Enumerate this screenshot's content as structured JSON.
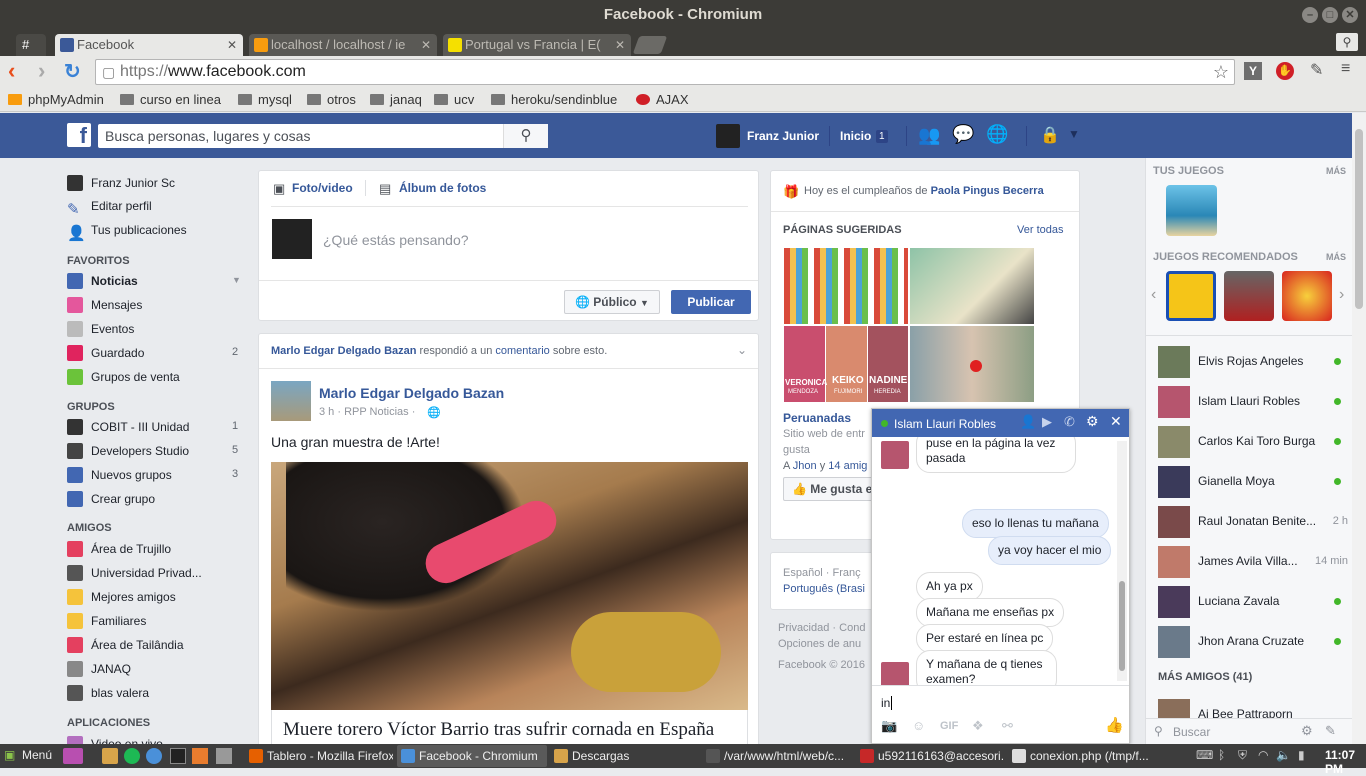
{
  "window": {
    "title": "Facebook - Chromium"
  },
  "tabs": [
    {
      "label": "#",
      "active": false
    },
    {
      "label": "Facebook",
      "active": true
    },
    {
      "label": "localhost / localhost / ie",
      "active": false
    },
    {
      "label": "Portugal vs Francia | E(",
      "active": false
    }
  ],
  "toolbar": {
    "url_scheme": "https://",
    "url_host": "www.facebook.com"
  },
  "bookmarks": [
    "phpMyAdmin",
    "curso en linea",
    "mysql",
    "otros",
    "janaq",
    "ucv",
    "heroku/sendinblue",
    "AJAX"
  ],
  "fb": {
    "search_placeholder": "Busca personas, lugares y cosas",
    "user_name": "Franz Junior",
    "home_label": "Inicio",
    "home_count": "1"
  },
  "left_nav": {
    "profile": [
      {
        "label": "Franz Junior Sc",
        "icon": "avatar"
      },
      {
        "label": "Editar perfil",
        "icon": "pencil-icon"
      },
      {
        "label": "Tus publicaciones",
        "icon": "person-icon"
      }
    ],
    "favoritos_title": "FAVORITOS",
    "favoritos": [
      {
        "label": "Noticias",
        "count": "",
        "bold": true,
        "color": "#4267b2"
      },
      {
        "label": "Mensajes",
        "count": "",
        "color": "#e4579c"
      },
      {
        "label": "Eventos",
        "count": "",
        "color": "#bbb"
      },
      {
        "label": "Guardado",
        "count": "2",
        "color": "#e0245e"
      },
      {
        "label": "Grupos de venta",
        "count": "",
        "color": "#6bc33a"
      }
    ],
    "grupos_title": "GRUPOS",
    "grupos": [
      {
        "label": "COBIT - III Unidad",
        "count": "1",
        "color": "#333"
      },
      {
        "label": "Developers Studio",
        "count": "5",
        "color": "#444"
      },
      {
        "label": "Nuevos grupos",
        "count": "3",
        "color": "#4267b2"
      },
      {
        "label": "Crear grupo",
        "count": "",
        "color": "#4267b2"
      }
    ],
    "amigos_title": "AMIGOS",
    "amigos": [
      {
        "label": "Área de Trujillo",
        "color": "#e4405f"
      },
      {
        "label": "Universidad Privad...",
        "color": "#555"
      },
      {
        "label": "Mejores amigos",
        "color": "#f5c33b"
      },
      {
        "label": "Familiares",
        "color": "#f5c33b"
      },
      {
        "label": "Área de Tailândia",
        "color": "#e4405f"
      },
      {
        "label": "JANAQ",
        "color": "#888"
      },
      {
        "label": "blas valera",
        "color": "#555"
      }
    ],
    "apps_title": "APLICACIONES",
    "apps": [
      {
        "label": "Video en vivo"
      }
    ]
  },
  "composer": {
    "tab_photo": "Foto/video",
    "tab_album": "Álbum de fotos",
    "placeholder": "¿Qué estás pensando?",
    "privacy": "Público",
    "publish": "Publicar"
  },
  "story": {
    "context_actor": "Marlo Edgar Delgado Bazan",
    "context_mid": " respondió a un ",
    "context_link": "comentario",
    "context_end": " sobre esto.",
    "author": "Marlo Edgar Delgado Bazan",
    "meta": "3 h · RPP Noticias ·",
    "text": "Una gran muestra de !Arte!",
    "link_title": "Muere torero Víctor Barrio tras sufrir cornada en España"
  },
  "rightcol": {
    "birthday_prefix": "Hoy es el cumpleaños de ",
    "birthday_name": "Paola Pingus Becerra",
    "suggested_title": "PÁGINAS SUGERIDAS",
    "see_all": "Ver todas",
    "page_name": "Peruanadas",
    "page_desc": "Sitio web de entr",
    "page_desc2": "gusta",
    "page_friends_prefix": "A ",
    "page_friend": "Jhon",
    "page_friends_mid": " y ",
    "page_friends_more": "14 amig",
    "like_btn": "Me gusta es",
    "langs_line1": "Español · Franç",
    "langs_line2": "Português (Brasi",
    "footer1": "Privacidad · Cond",
    "footer2": "Opciones de anu",
    "footer3": "Facebook © 2016",
    "img_caption_keiko": "KEIKO",
    "img_caption_nadine": "NADINE",
    "img_caption_veronica": "VERONICA",
    "img_caption_keiko_sub": "FUJIMORI",
    "img_caption_nadine_sub": "HEREDIA",
    "img_caption_veronica_sub": "MENDOZA"
  },
  "sidebar": {
    "games_title": "TUS JUEGOS",
    "more": "MÁS",
    "recommended_title": "JUEGOS RECOMENDADOS",
    "contacts": [
      {
        "name": "Elvis Rojas Angeles",
        "status": "online",
        "time": ""
      },
      {
        "name": "Islam Llauri Robles",
        "status": "online",
        "time": ""
      },
      {
        "name": "Carlos Kai Toro Burga",
        "status": "online",
        "time": ""
      },
      {
        "name": "Gianella Moya",
        "status": "online",
        "time": ""
      },
      {
        "name": "Raul Jonatan Benite...",
        "status": "idle",
        "time": "2 h"
      },
      {
        "name": "James Avila Villa...",
        "status": "idle",
        "time": "14 min"
      },
      {
        "name": "Luciana Zavala",
        "status": "online",
        "time": ""
      },
      {
        "name": "Jhon Arana Cruzate",
        "status": "online",
        "time": ""
      }
    ],
    "more_friends": "MÁS AMIGOS (41)",
    "partial_contact": "Aj Bee Pattraporn",
    "search_placeholder": "Buscar"
  },
  "chat": {
    "name": "Islam Llauri Robles",
    "messages": [
      {
        "from": "them",
        "text": "puse en la página la vez pasada"
      },
      {
        "from": "me",
        "text": "eso lo llenas tu mañana"
      },
      {
        "from": "me",
        "text": "ya voy hacer el mio"
      },
      {
        "from": "them",
        "text": "Ah ya px"
      },
      {
        "from": "them",
        "text": "Mañana me enseñas px"
      },
      {
        "from": "them",
        "text": "Per estaré en línea pc"
      },
      {
        "from": "them",
        "text": "Y mañana de q tienes examen?"
      }
    ],
    "input_value": "in",
    "gif_label": "GIF"
  },
  "taskbar": {
    "menu": "Menú",
    "tasks": [
      {
        "label": "Tablero - Mozilla Firefox",
        "color": "#e66000"
      },
      {
        "label": "Facebook - Chromium",
        "color": "#4a90d9"
      },
      {
        "label": "Descargas",
        "color": "#d8a44a"
      },
      {
        "label": "/var/www/html/web/c...",
        "color": "#555"
      },
      {
        "label": "u592116163@accesori...",
        "color": "#c62828"
      },
      {
        "label": "conexion.php (/tmp/f...",
        "color": "#ddd"
      }
    ],
    "clock": "11:07 PM"
  },
  "colors": {
    "fb_blue": "#3b5998",
    "link": "#365899",
    "online": "#42b72a"
  }
}
